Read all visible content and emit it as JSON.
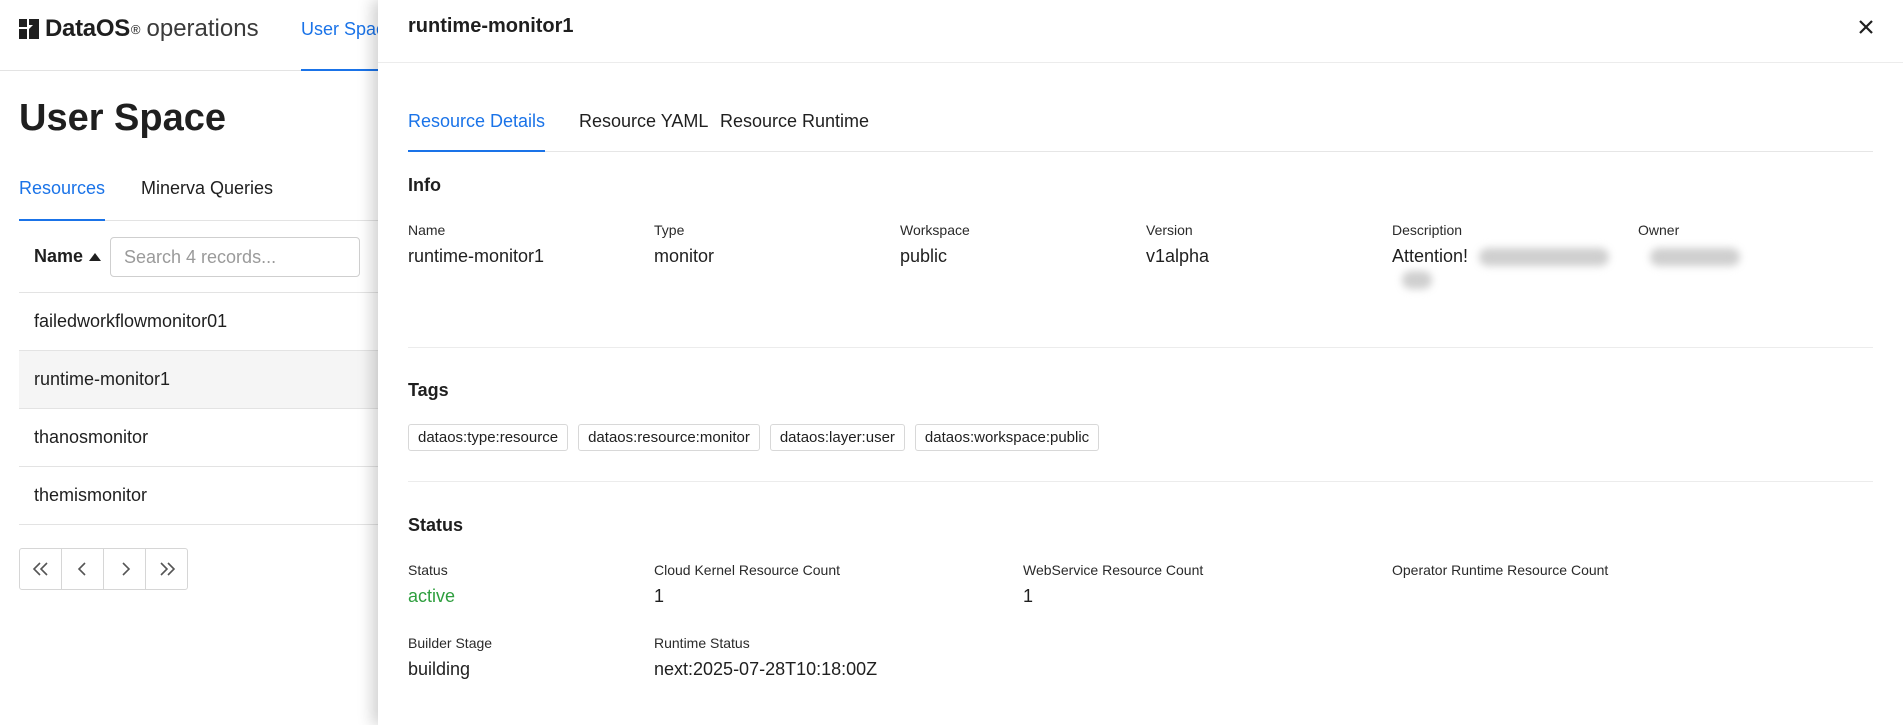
{
  "app": {
    "brand_strong": "DataOS",
    "brand_reg": "®",
    "brand_light": "operations",
    "nav_tab": "User Space"
  },
  "page": {
    "title": "User Space",
    "tabs": [
      {
        "label": "Resources",
        "active": true
      },
      {
        "label": "Minerva Queries",
        "active": false
      }
    ],
    "table": {
      "column_name": "Name",
      "search_placeholder": "Search 4 records...",
      "rows": [
        {
          "name": "failedworkflowmonitor01",
          "selected": false
        },
        {
          "name": "runtime-monitor1",
          "selected": true
        },
        {
          "name": "thanosmonitor",
          "selected": false
        },
        {
          "name": "themismonitor",
          "selected": false
        }
      ]
    },
    "pager_icons": [
      "first-page-icon",
      "prev-page-icon",
      "next-page-icon",
      "last-page-icon"
    ]
  },
  "drawer": {
    "title": "runtime-monitor1",
    "tabs": [
      {
        "label": "Resource Details",
        "active": true
      },
      {
        "label": "Resource YAML",
        "active": false
      },
      {
        "label": "Resource Runtime",
        "active": false
      }
    ],
    "info": {
      "section_title": "Info",
      "name_label": "Name",
      "name_value": "runtime-monitor1",
      "type_label": "Type",
      "type_value": "monitor",
      "workspace_label": "Workspace",
      "workspace_value": "public",
      "version_label": "Version",
      "version_value": "v1alpha",
      "description_label": "Description",
      "description_value": "Attention!",
      "owner_label": "Owner"
    },
    "tags": {
      "section_title": "Tags",
      "items": [
        "dataos:type:resource",
        "dataos:resource:monitor",
        "dataos:layer:user",
        "dataos:workspace:public"
      ]
    },
    "status": {
      "section_title": "Status",
      "status_label": "Status",
      "status_value": "active",
      "cloud_kernel_label": "Cloud Kernel Resource Count",
      "cloud_kernel_value": "1",
      "webservice_label": "WebService Resource Count",
      "webservice_value": "1",
      "operator_runtime_label": "Operator Runtime Resource Count",
      "builder_stage_label": "Builder Stage",
      "builder_stage_value": "building",
      "runtime_status_label": "Runtime Status",
      "runtime_status_value": "next:2025-07-28T10:18:00Z"
    }
  },
  "colors": {
    "accent": "#1a73e8",
    "active_status": "#2e9e3e"
  }
}
